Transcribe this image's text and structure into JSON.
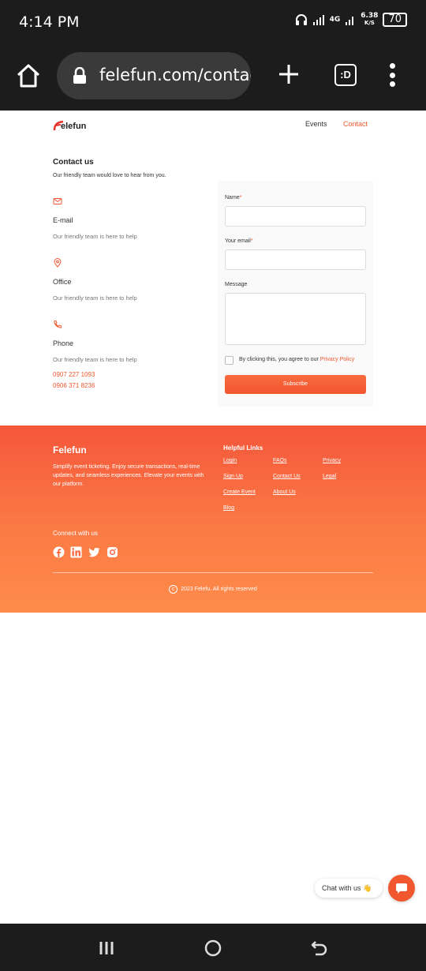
{
  "status_bar": {
    "time": "4:14 PM",
    "network": "4G",
    "speed_value": "6.38",
    "speed_unit": "K/S",
    "battery": "70"
  },
  "browser": {
    "url": "felefun.com/contac",
    "tabs_label": ":D"
  },
  "site": {
    "logo_text": "elefun",
    "nav": {
      "events": "Events",
      "contact": "Contact"
    }
  },
  "contact": {
    "title": "Contact us",
    "subtitle": "Our friendly team would love to hear from you.",
    "email": {
      "title": "E-mail",
      "desc": "Our friendly team is here to help"
    },
    "office": {
      "title": "Office",
      "desc": "Our friendly team is here to help"
    },
    "phone": {
      "title": "Phone",
      "desc": "Our friendly team is here to help",
      "numbers": [
        "0907 227 1093",
        "0906 371 8236"
      ]
    }
  },
  "form": {
    "name_label": "Name",
    "email_label": "Your email",
    "message_label": "Message",
    "required_mark": "*",
    "agree_text": "By clicking this, you agree to our ",
    "policy_link": "Privacy Policy",
    "submit_label": "Subscribe"
  },
  "footer": {
    "brand": "Felefun",
    "description": "Simplify event ticketing. Enjoy secure transactions, real-time updates, and seamless experiences. Elevate your events with our platform.",
    "links_title": "Helpful Links",
    "links": {
      "login": "Login",
      "faqs": "FAQs",
      "privacy": "Privacy",
      "signup": "Sign Up",
      "contact_us": "Contact Us",
      "legal": "Legal",
      "create_event": "Create Event",
      "about_us": "About Us",
      "blog": "Blog"
    },
    "connect": "Connect with us",
    "copyright": "2023 Felefu. All rights reserved"
  },
  "chat": {
    "label": "Chat with us 👋"
  },
  "colors": {
    "accent": "#f2582f",
    "dark": "#1c1c1c"
  }
}
